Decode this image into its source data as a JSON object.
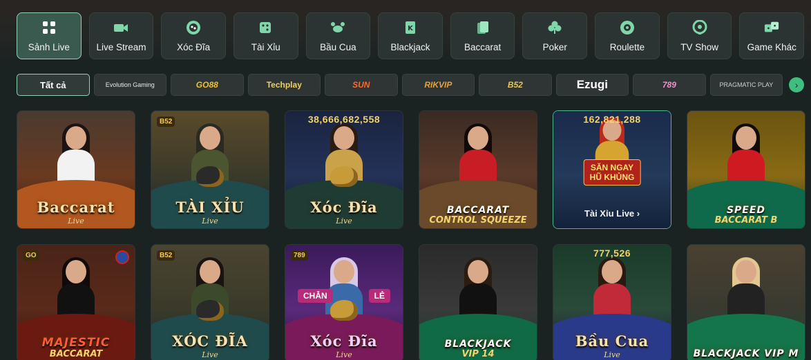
{
  "categories": [
    {
      "label": "Sảnh Live",
      "icon": "grid-icon",
      "active": true
    },
    {
      "label": "Live Stream",
      "icon": "camera-icon",
      "active": false
    },
    {
      "label": "Xóc Đĩa",
      "icon": "dice-plate-icon",
      "active": false
    },
    {
      "label": "Tài Xỉu",
      "icon": "dice-icon",
      "active": false
    },
    {
      "label": "Bầu Cua",
      "icon": "crab-icon",
      "active": false
    },
    {
      "label": "Blackjack",
      "icon": "card-k-icon",
      "active": false
    },
    {
      "label": "Baccarat",
      "icon": "card-icon",
      "active": false
    },
    {
      "label": "Poker",
      "icon": "club-icon",
      "active": false
    },
    {
      "label": "Roulette",
      "icon": "roulette-icon",
      "active": false
    },
    {
      "label": "TV Show",
      "icon": "tv-wheel-icon",
      "active": false
    },
    {
      "label": "Game Khác",
      "icon": "game-dice-icon",
      "active": false
    }
  ],
  "providers": [
    {
      "label": "Tất cả",
      "active": true
    },
    {
      "label": "Evolution Gaming"
    },
    {
      "label": "GO88"
    },
    {
      "label": "Techplay"
    },
    {
      "label": "SUN"
    },
    {
      "label": "RIKVIP"
    },
    {
      "label": "B52"
    },
    {
      "label": "Ezugi"
    },
    {
      "label": "789"
    },
    {
      "label": "PRAGMATIC PLAY"
    }
  ],
  "providers_next": "›",
  "games": [
    {
      "title": "Baccarat",
      "subtitle": "Live",
      "jackpot": "",
      "badge": "",
      "theme": "baccarat"
    },
    {
      "title": "TÀI XỈU",
      "subtitle": "Live",
      "jackpot": "",
      "badge": "B52",
      "theme": "taixiu"
    },
    {
      "title": "Xóc Đĩa",
      "subtitle": "Live",
      "jackpot": "38,666,682,558",
      "badge": "",
      "theme": "xocdia"
    },
    {
      "title": "BACCARAT",
      "subtitle": "CONTROL SQUEEZE",
      "jackpot": "",
      "badge": "",
      "theme": "squeeze"
    },
    {
      "title": "",
      "subtitle": "",
      "jackpot": "162,821,288",
      "badge": "",
      "theme": "promo",
      "promo": "SĂN NGAY\nHŨ KHỦNG",
      "link": "Tài Xỉu Live ›"
    },
    {
      "title": "SPEED",
      "subtitle": "BACCARAT B",
      "jackpot": "",
      "badge": "",
      "theme": "speed"
    },
    {
      "title": "MAJESTIC",
      "subtitle": "BACCARAT",
      "jackpot": "",
      "badge": "GO",
      "theme": "majestic"
    },
    {
      "title": "XÓC ĐĨA",
      "subtitle": "Live",
      "jackpot": "",
      "badge": "B52",
      "theme": "xocdia2"
    },
    {
      "title": "Xóc Đĩa",
      "subtitle": "Live",
      "jackpot": "",
      "badge": "789",
      "theme": "xocdia3",
      "chan": "CHẴN",
      "le": "LẺ"
    },
    {
      "title": "BLACKJACK",
      "subtitle": "VIP 14",
      "jackpot": "",
      "badge": "",
      "theme": "bj14"
    },
    {
      "title": "Bầu Cua",
      "subtitle": "Live",
      "jackpot": "777,526",
      "badge": "",
      "theme": "baucua"
    },
    {
      "title": "BLACKJACK VIP M",
      "subtitle": "",
      "jackpot": "",
      "badge": "",
      "theme": "bjm"
    }
  ]
}
